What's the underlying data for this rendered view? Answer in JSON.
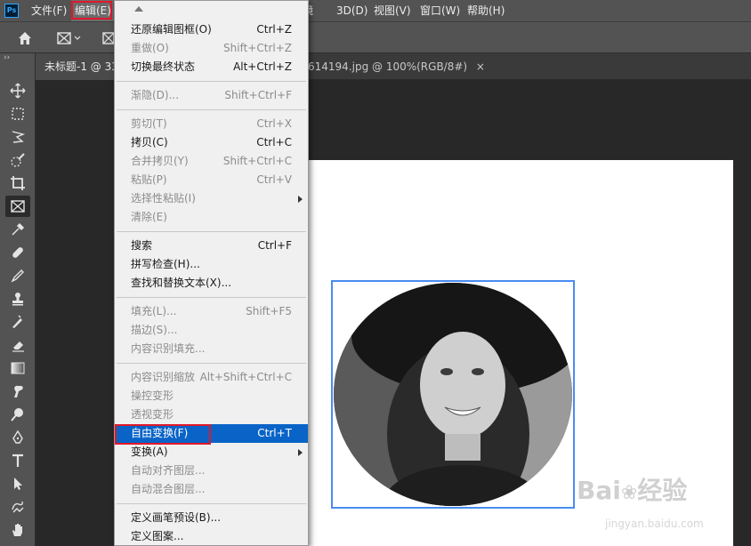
{
  "menubar": {
    "logo": "Ps",
    "items": [
      "文件(F)",
      "编辑(E)",
      "镜",
      "3D(D)",
      "视图(V)",
      "窗口(W)",
      "帮助(H)"
    ]
  },
  "tabs": [
    {
      "label": "未标题-1 @ 33"
    },
    {
      "label": "614194.jpg @ 100%(RGB/8#)",
      "close": "×"
    }
  ],
  "dropdown": {
    "items": [
      {
        "label": "还原编辑图框(O)",
        "shortcut": "Ctrl+Z",
        "disabled": false
      },
      {
        "label": "重做(O)",
        "shortcut": "Shift+Ctrl+Z",
        "disabled": true
      },
      {
        "label": "切换最终状态",
        "shortcut": "Alt+Ctrl+Z",
        "disabled": false
      },
      {
        "label": "渐隐(D)...",
        "shortcut": "Shift+Ctrl+F",
        "disabled": true
      },
      {
        "label": "剪切(T)",
        "shortcut": "Ctrl+X",
        "disabled": true
      },
      {
        "label": "拷贝(C)",
        "shortcut": "Ctrl+C",
        "disabled": false
      },
      {
        "label": "合并拷贝(Y)",
        "shortcut": "Shift+Ctrl+C",
        "disabled": true
      },
      {
        "label": "粘贴(P)",
        "shortcut": "Ctrl+V",
        "disabled": true
      },
      {
        "label": "选择性粘贴(I)",
        "shortcut": "",
        "disabled": true
      },
      {
        "label": "清除(E)",
        "shortcut": "",
        "disabled": true
      },
      {
        "label": "搜索",
        "shortcut": "Ctrl+F",
        "disabled": false
      },
      {
        "label": "拼写检查(H)...",
        "shortcut": "",
        "disabled": false
      },
      {
        "label": "查找和替换文本(X)...",
        "shortcut": "",
        "disabled": false
      },
      {
        "label": "填充(L)...",
        "shortcut": "Shift+F5",
        "disabled": true
      },
      {
        "label": "描边(S)...",
        "shortcut": "",
        "disabled": true
      },
      {
        "label": "内容识别填充...",
        "shortcut": "",
        "disabled": true
      },
      {
        "label": "内容识别缩放",
        "shortcut": "Alt+Shift+Ctrl+C",
        "disabled": true
      },
      {
        "label": "操控变形",
        "shortcut": "",
        "disabled": true
      },
      {
        "label": "透视变形",
        "shortcut": "",
        "disabled": true
      },
      {
        "label": "自由变换(F)",
        "shortcut": "Ctrl+T",
        "disabled": false,
        "highlighted": true
      },
      {
        "label": "变换(A)",
        "shortcut": "",
        "disabled": false
      },
      {
        "label": "自动对齐图层...",
        "shortcut": "",
        "disabled": true
      },
      {
        "label": "自动混合图层...",
        "shortcut": "",
        "disabled": true
      },
      {
        "label": "定义画笔预设(B)...",
        "shortcut": "",
        "disabled": false
      },
      {
        "label": "定义图案...",
        "shortcut": "",
        "disabled": false
      }
    ]
  },
  "watermark": {
    "brand": "Bai",
    "brand2": "经验",
    "url": "jingyan.baidu.com"
  },
  "icons": {
    "home": "home-icon",
    "frame": "frame-tool-icon"
  }
}
